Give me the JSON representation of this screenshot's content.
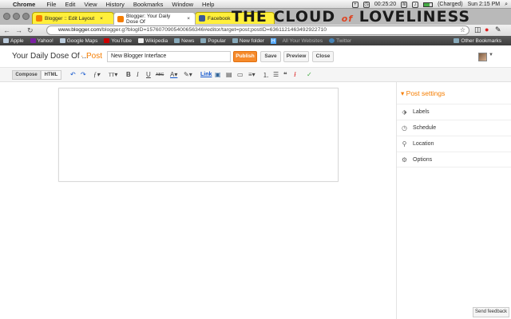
{
  "menubar": {
    "app": "Chrome",
    "items": [
      "File",
      "Edit",
      "View",
      "History",
      "Bookmarks",
      "Window",
      "Help"
    ],
    "time_counter": "00:25:20",
    "battery": "(Charged)",
    "clock": "Sun 2:15 PM"
  },
  "tabs": [
    {
      "label": "Blogger :: Edit Layout",
      "color": "#f57d00"
    },
    {
      "label": "Blogger: Your Daily Dose Of",
      "color": "#f57d00"
    },
    {
      "label": "Facebook",
      "color": "#3b5998"
    }
  ],
  "decoration": {
    "logo_main": "THE CLOUD ",
    "logo_of": "of",
    "logo_tail": " LOVELINESS"
  },
  "address": {
    "host": "www.blogger.com",
    "path": "/blogger.g?blogID=1576070905400656346#editor/target=post;postID=6361121463492922710"
  },
  "bookmarks": [
    {
      "label": "Apple"
    },
    {
      "label": "Yahoo!"
    },
    {
      "label": "Google Maps"
    },
    {
      "label": "YouTube"
    },
    {
      "label": "Wikipedia"
    },
    {
      "label": "News"
    },
    {
      "label": "Popular"
    },
    {
      "label": "New folder"
    },
    {
      "label": "H"
    },
    {
      "label": "All Your Websites"
    },
    {
      "label": "Twitter"
    }
  ],
  "bookmarks_other": "Other Bookmarks",
  "blogger": {
    "blog_title": "Your Daily Dose Of ...",
    "separator": "·",
    "section": "Post",
    "post_title_value": "New Blogger Interface",
    "publish": "Publish",
    "save": "Save",
    "preview": "Preview",
    "close": "Close"
  },
  "toolbar": {
    "compose": "Compose",
    "html": "HTML",
    "link": "Link"
  },
  "sidebar": {
    "header": "Post settings",
    "items": [
      {
        "label": "Labels",
        "icon": "tag-icon"
      },
      {
        "label": "Schedule",
        "icon": "clock-icon"
      },
      {
        "label": "Location",
        "icon": "map-pin-icon"
      },
      {
        "label": "Options",
        "icon": "gear-icon"
      }
    ],
    "send_feedback": "Send feedback"
  },
  "colors": {
    "accent": "#f57d00",
    "publish": "#f68a2a",
    "tab_theme": "#ffef3b"
  }
}
